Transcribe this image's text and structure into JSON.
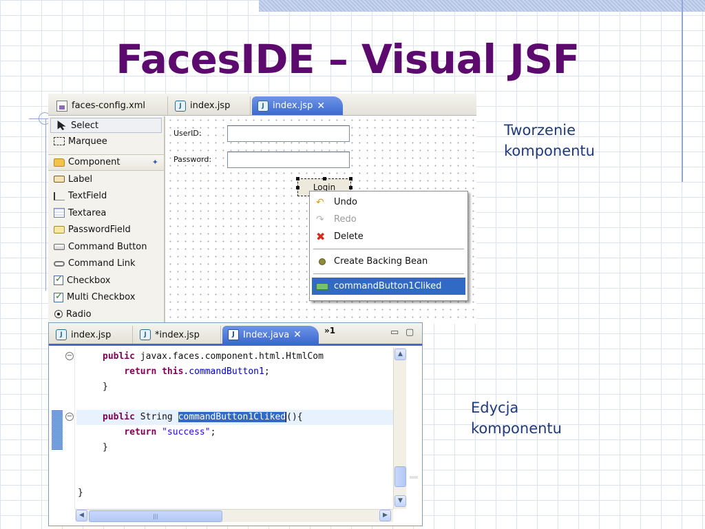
{
  "slide": {
    "title": "FacesIDE – Visual JSF",
    "caption_top": "Tworzenie komponentu",
    "caption_bottom": "Edycja komponentu"
  },
  "designer": {
    "tabs": [
      {
        "label": "faces-config.xml",
        "icon": "xml-file-icon",
        "active": false
      },
      {
        "label": "index.jsp",
        "icon": "jsp-file-icon",
        "active": false
      },
      {
        "label": "index.jsp",
        "icon": "jsp-file-icon",
        "active": true,
        "close": "✕"
      }
    ],
    "palette": {
      "tools": [
        {
          "label": "Select",
          "icon": "arrow-cursor-icon"
        },
        {
          "label": "Marquee",
          "icon": "marquee-icon"
        }
      ],
      "group": {
        "label": "Component",
        "icon": "folder-icon",
        "pin": "📌"
      },
      "items": [
        {
          "label": "Label",
          "icon": "label-icon"
        },
        {
          "label": "TextField",
          "icon": "textfield-icon"
        },
        {
          "label": "Textarea",
          "icon": "textarea-icon"
        },
        {
          "label": "PasswordField",
          "icon": "passwordfield-icon"
        },
        {
          "label": "Command Button",
          "icon": "command-button-icon"
        },
        {
          "label": "Command Link",
          "icon": "command-link-icon"
        },
        {
          "label": "Checkbox",
          "icon": "checkbox-icon"
        },
        {
          "label": "Multi Checkbox",
          "icon": "multi-checkbox-icon"
        },
        {
          "label": "Radio",
          "icon": "radio-icon"
        }
      ]
    },
    "form": {
      "userid_label": "UserID:",
      "password_label": "Password:",
      "userid_value": "",
      "password_value": "",
      "login_label": "Login"
    },
    "context_menu": {
      "undo": "Undo",
      "redo": "Redo",
      "delete": "Delete",
      "create_bean": "Create Backing Bean",
      "method": "commandButton1Cliked"
    }
  },
  "editor": {
    "tabs": [
      {
        "label": "index.jsp",
        "active": false
      },
      {
        "label": "*index.jsp",
        "active": false
      },
      {
        "label": "Index.java",
        "active": true,
        "close": "✕"
      }
    ],
    "overflow": "»1",
    "minimize": "▭",
    "maximize": "▢",
    "code": {
      "l1_kw": "public",
      "l1_rest": " javax.faces.component.html.HtmlCom",
      "l2_kw1": "return",
      "l2_kw2": "this",
      "l2_fld": ".commandButton1",
      "l2_end": ";",
      "l3": "}",
      "l4_kw": "public",
      "l4_mid": " String ",
      "l4_sel": "commandButton1Cliked",
      "l4_end": "(){",
      "l5_kw": "return",
      "l5_str": "\"success\"",
      "l5_end": ";",
      "l6": "}",
      "l7": "}"
    }
  },
  "colors": {
    "title": "#5c0a6d",
    "caption": "#1f3a7a",
    "accent_tab": "#3c69cf",
    "keyword": "#7f0055",
    "selection": "#316ac5"
  }
}
